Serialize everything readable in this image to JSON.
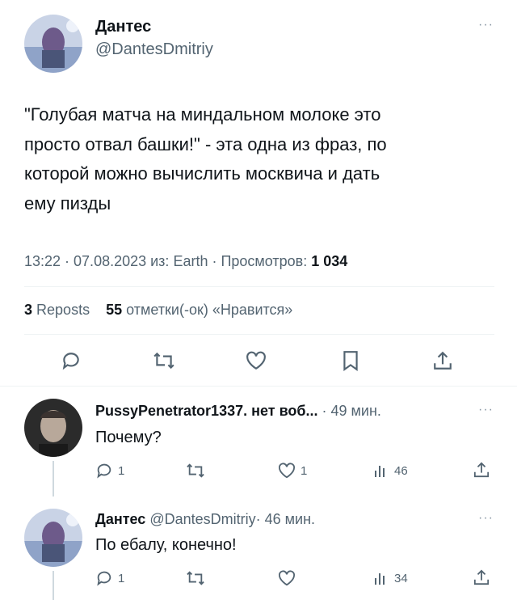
{
  "main_tweet": {
    "author_name": "Дантес",
    "author_handle": "@DantesDmitriy",
    "text_lines": [
      "\"Голубая матча на миндальном молоке это",
      "просто отвал башки!\" - эта одна из фраз, по",
      "которой можно вычислить москвича и дать",
      "ему пизды"
    ],
    "meta_prefix": "13:22 · 07.08.2023 из: Earth · Просмотров: ",
    "views": "1 034",
    "reposts_count": "3",
    "reposts_label": "Reposts",
    "likes_count": "55",
    "likes_label": "отметки(-ок) «Нравится»",
    "more": "···"
  },
  "replies": [
    {
      "author_name": "PussyPenetrator1337. нет воб...",
      "time": "· 49 мин.",
      "text": "Почему?",
      "reply_count": "1",
      "like_count": "1",
      "views": "46",
      "more": "···"
    },
    {
      "author_name": "Дантес",
      "author_handle": "@DantesDmitriy",
      "time": "· 46 мин.",
      "text": "По ебалу, конечно!",
      "reply_count": "1",
      "views": "34",
      "more": "···"
    }
  ],
  "icons": [
    "reply-icon",
    "retweet-icon",
    "heart-icon",
    "bookmark-icon",
    "share-icon",
    "views-icon",
    "more-icon"
  ],
  "colors": {
    "text": "#0f1419",
    "muted": "#536471",
    "divider": "#eff3f4"
  }
}
